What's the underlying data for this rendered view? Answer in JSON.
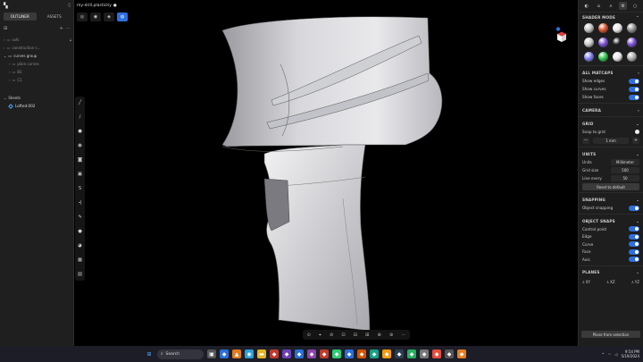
{
  "window": {
    "title": "my-drill.plasticity",
    "modified_marker": "●"
  },
  "left_panel": {
    "tabs": [
      {
        "label": "OUTLINER",
        "active": true
      },
      {
        "label": "ASSETS",
        "active": false
      }
    ],
    "tree": [
      {
        "label": "sofs",
        "bright": false,
        "locked": true
      },
      {
        "label": "construction s…",
        "bright": false,
        "locked": false
      },
      {
        "label": "curves group",
        "bright": true,
        "locked": false
      },
      {
        "label": "plain curves",
        "bright": false,
        "locked": false
      },
      {
        "label": "B1",
        "bright": false,
        "locked": false
      },
      {
        "label": "C1",
        "bright": false,
        "locked": false
      }
    ],
    "sheets_label": "Sheets",
    "sheet_items": [
      "Lofted.002"
    ]
  },
  "viewport": {
    "top_buttons": [
      "◎",
      "◉",
      "◈",
      "◍"
    ],
    "bottom_toolbar": [
      "⊙",
      "⌖",
      "⊘",
      "⊡",
      "⊟",
      "⊞",
      "⊕",
      "⊛",
      "⋯"
    ],
    "nav_cube_colors": {
      "top": "#e03b3b",
      "left": "#ffffff",
      "badge": "#2e6fe0"
    }
  },
  "right_panel": {
    "sections": {
      "shader_mode": "SHADER MODE",
      "all_matcaps": "ALL MATCAPS",
      "camera": "CAMERA",
      "grid": "GRID",
      "units": "UNITS",
      "snapping": "SNAPPING",
      "object_snaps": "OBJECT SNAPS",
      "planes": "PLANES"
    },
    "matcap_colors": [
      "#bfbfbf",
      "#d9532c",
      "#e8e8e8",
      "#8d8d8d",
      "#c8c8c8",
      "#7a4fd1",
      "#1a1a1a",
      "#7a4fd1",
      "#7d7df0",
      "#33c24f",
      "#e6e6e6",
      "#a9a9a9"
    ],
    "display_toggles": [
      {
        "label": "Show edges",
        "on": true
      },
      {
        "label": "Show curves",
        "on": true
      },
      {
        "label": "Show faces",
        "on": true
      }
    ],
    "snap_to_grid": "Snap to grid",
    "grid_value": "1 mm",
    "units_label": "Units",
    "units_value": "Millimeter",
    "grid_size_label": "Grid size",
    "grid_size_value": "500",
    "line_every_label": "Line every",
    "line_every_value": "50",
    "reset_button": "Reset to default",
    "object_snapping": {
      "label": "Object snapping",
      "on": true
    },
    "object_snaps": [
      {
        "label": "Control point",
        "on": true
      },
      {
        "label": "Edge",
        "on": true
      },
      {
        "label": "Curve",
        "on": true
      },
      {
        "label": "Face",
        "on": true
      },
      {
        "label": "Axis",
        "on": true
      }
    ],
    "planes": [
      "XY",
      "XZ",
      "YZ"
    ],
    "plane_from_selection": "Plane from selection"
  },
  "taskbar": {
    "search_label": "Search",
    "time": "9:54 PM",
    "date": "5/19/2024",
    "tray_text": "^"
  }
}
